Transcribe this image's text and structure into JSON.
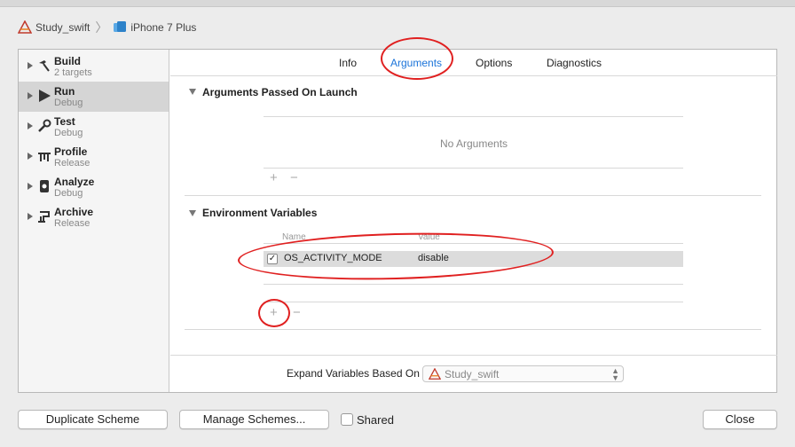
{
  "breadcrumb": {
    "project": "Study_swift",
    "device": "iPhone 7 Plus"
  },
  "sidebar": {
    "items": [
      {
        "name": "Build",
        "sub": "2 targets",
        "icon": "hammer-icon"
      },
      {
        "name": "Run",
        "sub": "Debug",
        "icon": "play-icon"
      },
      {
        "name": "Test",
        "sub": "Debug",
        "icon": "wrench-icon"
      },
      {
        "name": "Profile",
        "sub": "Release",
        "icon": "instruments-icon"
      },
      {
        "name": "Analyze",
        "sub": "Debug",
        "icon": "analyze-icon"
      },
      {
        "name": "Archive",
        "sub": "Release",
        "icon": "archive-icon"
      }
    ],
    "selected": "Run"
  },
  "tabs": {
    "info": "Info",
    "arguments": "Arguments",
    "options": "Options",
    "diagnostics": "Diagnostics",
    "active": "Arguments"
  },
  "arguments": {
    "title": "Arguments Passed On Launch",
    "empty": "No Arguments",
    "add": "+",
    "remove": "−"
  },
  "environment": {
    "title": "Environment Variables",
    "col_name": "Name",
    "col_value": "Value",
    "rows": [
      {
        "checked": "✓",
        "name": "OS_ACTIVITY_MODE",
        "value": "disable"
      }
    ],
    "add": "+",
    "remove": "−"
  },
  "expand": {
    "label": "Expand Variables Based On",
    "value": "Study_swift"
  },
  "footer": {
    "duplicate": "Duplicate Scheme",
    "manage": "Manage Schemes...",
    "shared": "Shared",
    "close": "Close"
  },
  "colors": {
    "accent": "#1a73d9",
    "annotation": "#e02020",
    "selected_row": "#d5d5d5"
  }
}
